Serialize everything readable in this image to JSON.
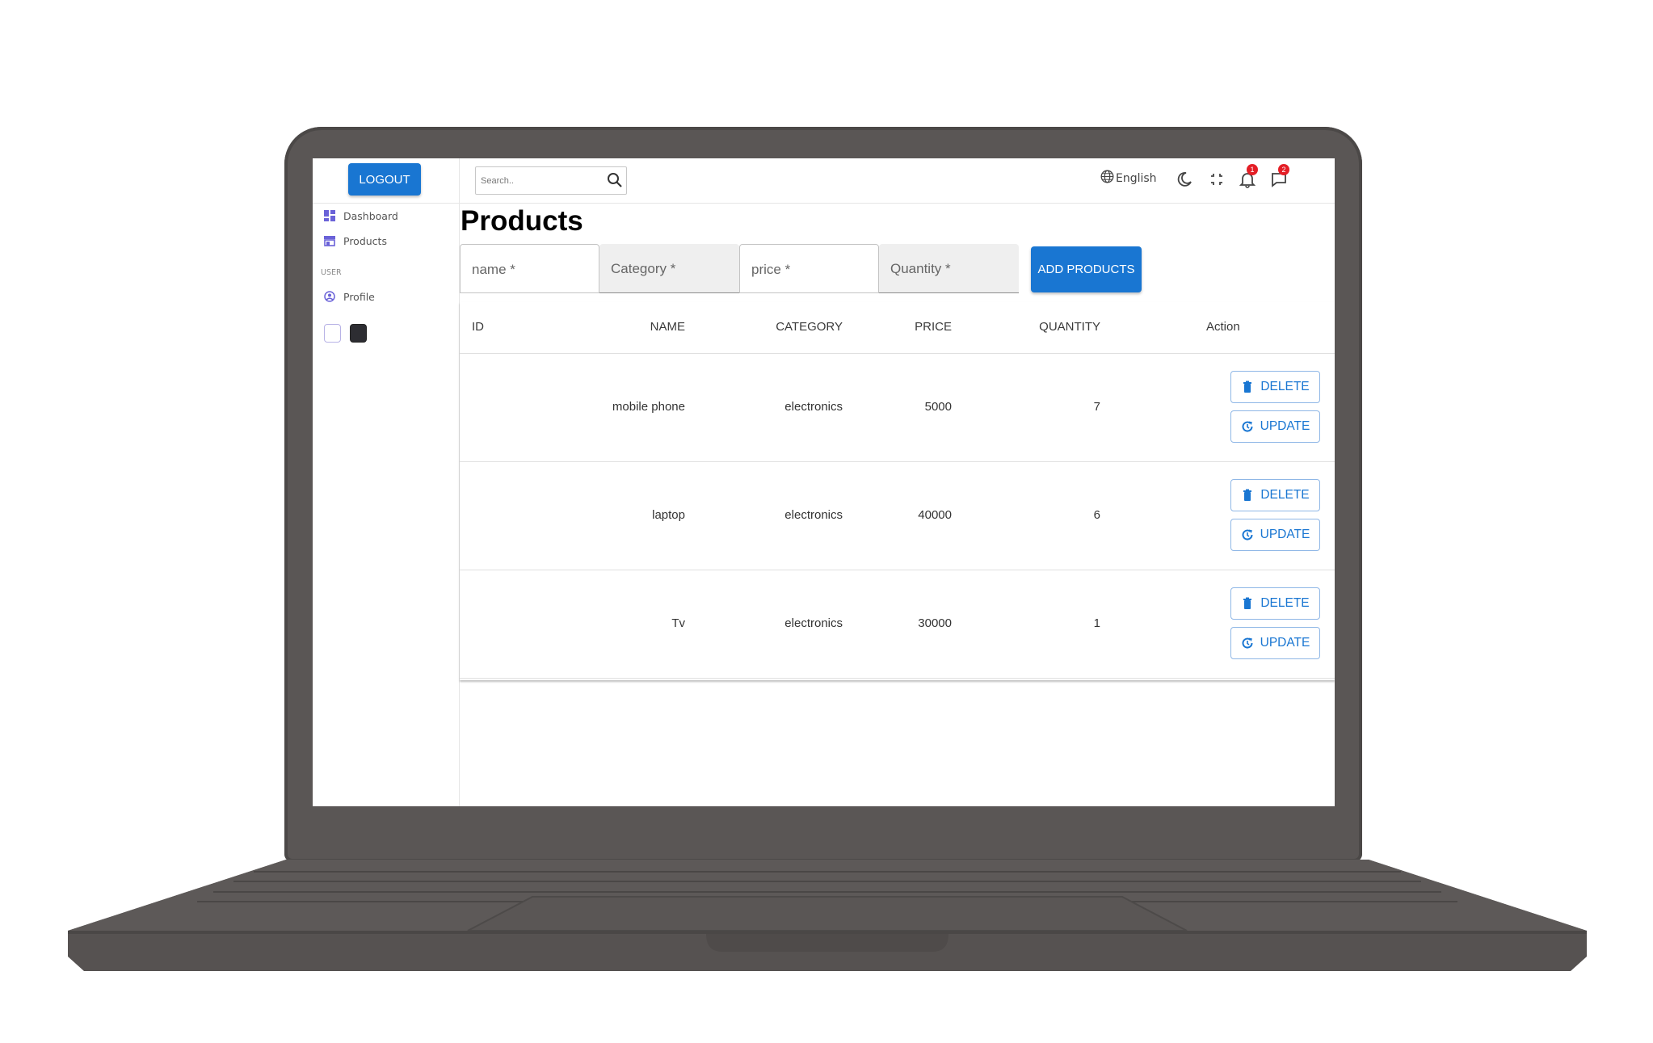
{
  "sidebar": {
    "logout_label": "LOGOUT",
    "items": [
      {
        "label": "Dashboard",
        "icon": "dashboard-icon"
      },
      {
        "label": "Products",
        "icon": "store-icon"
      }
    ],
    "section_label": "USER",
    "profile": {
      "label": "Profile",
      "icon": "account-circle-icon"
    },
    "theme_swatches": [
      "#ffffff",
      "#2d2d32"
    ]
  },
  "header": {
    "search_placeholder": "Search..",
    "language": "English",
    "notifications_count": "1",
    "messages_count": "2"
  },
  "page": {
    "title": "Products",
    "form": {
      "name_placeholder": "name *",
      "category_placeholder": "Category *",
      "price_placeholder": "price *",
      "quantity_placeholder": "Quantity *",
      "add_label": "ADD PRODUCTS"
    },
    "table": {
      "columns": [
        "ID",
        "NAME",
        "CATEGORY",
        "PRICE",
        "QUANTITY",
        "Action"
      ],
      "rows": [
        {
          "id": "",
          "name": "mobile phone",
          "category": "electronics",
          "price": "5000",
          "quantity": "7"
        },
        {
          "id": "",
          "name": "laptop",
          "category": "electronics",
          "price": "40000",
          "quantity": "6"
        },
        {
          "id": "",
          "name": "Tv",
          "category": "electronics",
          "price": "30000",
          "quantity": "1"
        }
      ],
      "delete_label": "DELETE",
      "update_label": "UPDATE"
    }
  },
  "colors": {
    "primary": "#1976d2",
    "badge": "#e41e26",
    "laptop_frame": "#5a5655"
  }
}
